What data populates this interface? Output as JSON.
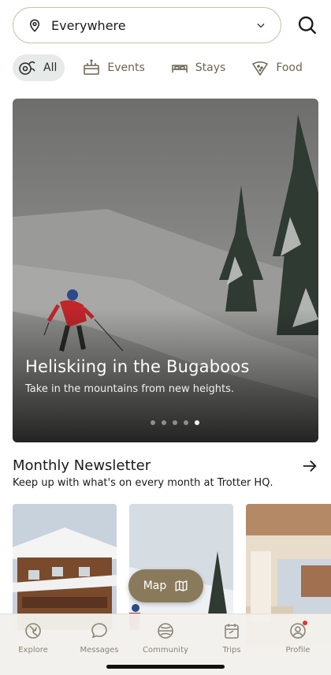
{
  "search": {
    "location": "Everywhere"
  },
  "categories": [
    {
      "label": "All",
      "icon": "all-icon",
      "active": true
    },
    {
      "label": "Events",
      "icon": "events-icon",
      "active": false
    },
    {
      "label": "Stays",
      "icon": "bed-icon",
      "active": false
    },
    {
      "label": "Food",
      "icon": "food-icon",
      "active": false
    },
    {
      "label": "",
      "icon": "drinks-icon",
      "active": false
    }
  ],
  "hero": {
    "title": "Heliskiing in the Bugaboos",
    "subtitle": "Take in the mountains from new heights.",
    "slide_count": 5,
    "active_slide": 5
  },
  "newsletter": {
    "title": "Monthly Newsletter",
    "subtitle": "Keep up with what's on every month at Trotter HQ."
  },
  "map_button": {
    "label": "Map"
  },
  "tabs": [
    {
      "label": "Explore",
      "icon": "explore-icon"
    },
    {
      "label": "Messages",
      "icon": "messages-icon"
    },
    {
      "label": "Community",
      "icon": "community-icon"
    },
    {
      "label": "Trips",
      "icon": "trips-icon"
    },
    {
      "label": "Profile",
      "icon": "profile-icon",
      "badge": true
    }
  ],
  "colors": {
    "accent": "#8a7a5c",
    "pill_border": "#c9c1ac",
    "chip_active_bg": "#e6eae9",
    "tabbar_bg": "#f2f0ec",
    "badge": "#e0352b"
  }
}
